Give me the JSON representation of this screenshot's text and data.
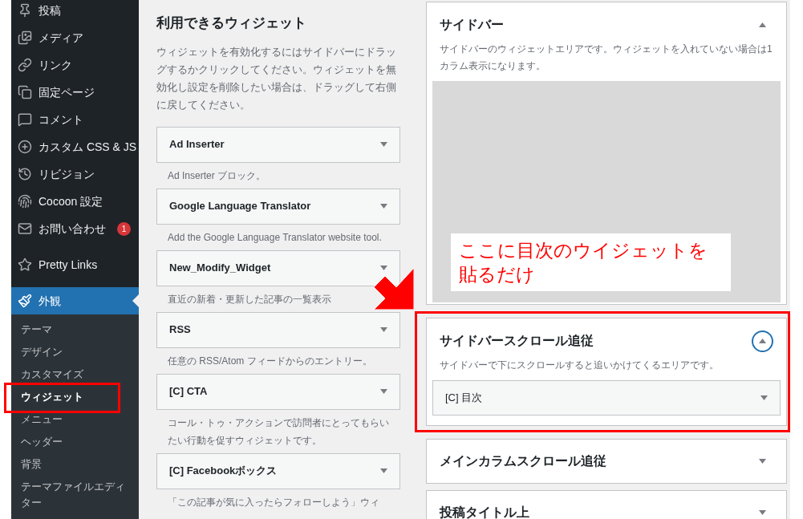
{
  "admin_menu": {
    "items": [
      {
        "label": "投稿",
        "selected": false
      },
      {
        "label": "メディア",
        "selected": false
      },
      {
        "label": "リンク",
        "selected": false
      },
      {
        "label": "固定ページ",
        "selected": false
      },
      {
        "label": "コメント",
        "selected": false
      },
      {
        "label": "カスタム CSS & JS",
        "selected": false
      },
      {
        "label": "リビジョン",
        "selected": false
      },
      {
        "label": "Cocoon 設定",
        "selected": false
      },
      {
        "label": "お問い合わせ",
        "selected": false,
        "badge": "1"
      },
      {
        "label": "Pretty Links",
        "selected": false
      },
      {
        "label": "外観",
        "selected": true
      }
    ],
    "submenu": [
      {
        "label": "テーマ",
        "selected": false
      },
      {
        "label": "デザイン",
        "selected": false
      },
      {
        "label": "カスタマイズ",
        "selected": false
      },
      {
        "label": "ウィジェット",
        "selected": true
      },
      {
        "label": "メニュー",
        "selected": false
      },
      {
        "label": "ヘッダー",
        "selected": false
      },
      {
        "label": "背景",
        "selected": false
      },
      {
        "label": "テーマファイルエディター",
        "selected": false
      }
    ]
  },
  "available_widgets": {
    "title": "利用できるウィジェット",
    "description": "ウィジェットを有効化するにはサイドバーにドラッグするかクリックしてください。ウィジェットを無効化し設定を削除したい場合は、ドラッグして右側に戻してください。",
    "widgets": [
      {
        "name": "Ad Inserter",
        "description": "Ad Inserter ブロック。"
      },
      {
        "name": "Google Language Translator",
        "description": "Add the Google Language Translator website tool."
      },
      {
        "name": "New_Modify_Widget",
        "description": "直近の新着・更新した記事の一覧表示"
      },
      {
        "name": "RSS",
        "description": "任意の RSS/Atom フィードからのエントリー。"
      },
      {
        "name": "[C] CTA",
        "description": "コール・トゥ・アクションで訪問者にとってもらいたい行動を促すウィジェットです。"
      },
      {
        "name": "[C] Facebookボックス",
        "description": "「この記事が気に入ったらフォローしよう」ウィ"
      }
    ]
  },
  "widget_areas": [
    {
      "title": "サイドバー",
      "expanded": true,
      "focused": false,
      "description": "サイドバーのウィジェットエリアです。ウィジェットを入れていない場合は1カラム表示になります。",
      "callout": "ここに目次のウイジェットを貼るだけ"
    },
    {
      "title": "サイドバースクロール追従",
      "expanded": true,
      "focused": true,
      "highlighted": true,
      "description": "サイドバーで下にスクロールすると追いかけてくるエリアです。",
      "widgets": [
        {
          "name": "[C] 目次"
        }
      ]
    },
    {
      "title": "メインカラムスクロール追従",
      "expanded": false,
      "focused": false
    },
    {
      "title": "投稿タイトル上",
      "expanded": false,
      "focused": false
    }
  ]
}
